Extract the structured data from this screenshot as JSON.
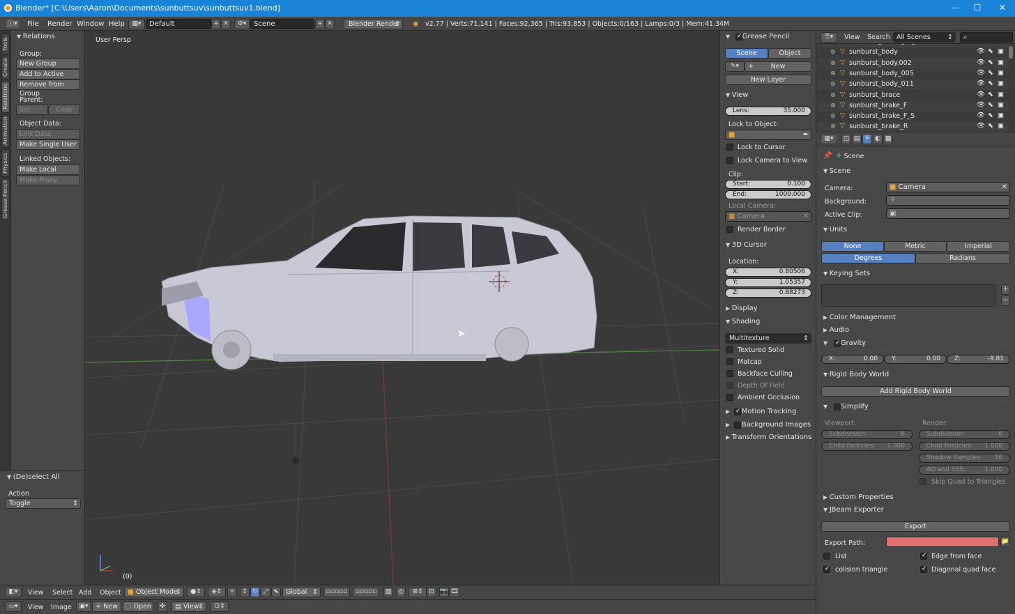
{
  "window": {
    "title": "Blender* [C:\\Users\\Aaron\\Documents\\sunbuttsuv\\sunbuttsuv1.blend]",
    "minimize": "—",
    "maximize": "☐",
    "close": "✕"
  },
  "infobar": {
    "menus": [
      "File",
      "Render",
      "Window",
      "Help"
    ],
    "layout": "Default",
    "scene": "Scene",
    "engine": "Blender Render",
    "stats": "v2.77 | Verts:71,141 | Faces:92,365 | Tris:93,853 | Objects:0/163 | Lamps:0/3 | Mem:41.34M"
  },
  "toolstrip": {
    "tabs": [
      "Tools",
      "Create",
      "Relations",
      "Animation",
      "Physics",
      "Grease Pencil"
    ]
  },
  "toolshelf": {
    "panel_title": "Relations",
    "group_label": "Group:",
    "new_group": "New Group",
    "add_to_active": "Add to Active",
    "remove_from_group": "Remove from Group",
    "parent_label": "Parent:",
    "set": "Set",
    "clear": "Clear",
    "object_data_label": "Object Data:",
    "link_data": "Link Data",
    "make_single_user": "Make Single User",
    "linked_objects_label": "Linked Objects:",
    "make_local": "Make Local",
    "make_proxy": "Make Proxy"
  },
  "operator": {
    "title": "(De)select All",
    "action_label": "Action",
    "action_value": "Toggle"
  },
  "viewport": {
    "label": "User Persp",
    "frame": "(0)"
  },
  "npanel": {
    "grease_pencil": "Grease Pencil",
    "scene_btn": "Scene",
    "object_btn": "Object",
    "new_btn": "New",
    "new_layer": "New Layer",
    "view": "View",
    "lens_label": "Lens:",
    "lens_value": "35.000",
    "lock_to_object": "Lock to Object:",
    "lock_to_cursor": "Lock to Cursor",
    "lock_camera_to_view": "Lock Camera to View",
    "clip": "Clip:",
    "start_label": "Start:",
    "start_value": "0.100",
    "end_label": "End:",
    "end_value": "1000.000",
    "local_camera": "Local Camera:",
    "camera": "Camera",
    "render_border": "Render Border",
    "cursor": "3D Cursor",
    "location": "Location:",
    "x_label": "X:",
    "x_value": "0.80506",
    "y_label": "Y:",
    "y_value": "1.05357",
    "z_label": "Z:",
    "z_value": "0.88273",
    "display": "Display",
    "shading": "Shading",
    "shading_mode": "Multitexture",
    "textured_solid": "Textured Solid",
    "matcap": "Matcap",
    "backface_culling": "Backface Culling",
    "depth_of_field": "Depth Of Field",
    "ambient_occlusion": "Ambient Occlusion",
    "motion_tracking": "Motion Tracking",
    "background_images": "Background Images",
    "transform_orientations": "Transform Orientations"
  },
  "outliner": {
    "view": "View",
    "search": "Search",
    "filter": "All Scenes",
    "items": [
      "sunburst_backlight_int",
      "sunburst_body",
      "sunburst_body.002",
      "sunburst_body_005",
      "sunburst_body_011",
      "sunburst_brace",
      "sunburst_brake_F",
      "sunburst_brake_F_S",
      "sunburst_brake_R"
    ]
  },
  "properties": {
    "context": "Scene",
    "scene_panel": "Scene",
    "camera_label": "Camera:",
    "camera_value": "Camera",
    "background_label": "Background:",
    "active_clip_label": "Active Clip:",
    "units": "Units",
    "unit_none": "None",
    "unit_metric": "Metric",
    "unit_imperial": "Imperial",
    "degrees": "Degrees",
    "radians": "Radians",
    "keying_sets": "Keying Sets",
    "color_management": "Color Management",
    "audio": "Audio",
    "gravity": "Gravity",
    "gx": "X:",
    "gx_val": "0.00",
    "gy": "Y:",
    "gy_val": "0.00",
    "gz": "Z:",
    "gz_val": "-9.81",
    "rigid_body_world": "Rigid Body World",
    "add_rigid_body_world": "Add Rigid Body World",
    "simplify": "Simplify",
    "viewport_label": "Viewport:",
    "render_label": "Render:",
    "subdivision": "Subdivision:",
    "sub_vp": "6",
    "sub_r": "6",
    "child_particles": "Child Particles:",
    "cp_vp": "1.000",
    "cp_r": "1.000",
    "shadow_samples": "Shadow Samples:",
    "ss_val": "16",
    "ao_sss": "AO and SSS:",
    "ao_val": "1.000",
    "skip_quad": "Skip Quad to Triangles",
    "custom_properties": "Custom Properties",
    "jbeam": "JBeam Exporter",
    "export": "Export",
    "export_path": "Export Path:",
    "list": "List",
    "edge_from_face": "Edge from face",
    "colision_triangle": "colision triangle",
    "diagonal_quad_face": "Diagonal quad face"
  },
  "viewheader": {
    "view": "View",
    "select": "Select",
    "add": "Add",
    "object": "Object",
    "mode": "Object Mode",
    "orientation": "Global"
  },
  "imageheader": {
    "view": "View",
    "image": "Image",
    "new": "New",
    "open": "Open",
    "view2": "View"
  },
  "colors": {
    "accent": "#5680c2",
    "titlebar": "#1883d7",
    "export_path_field": "#e07070"
  }
}
